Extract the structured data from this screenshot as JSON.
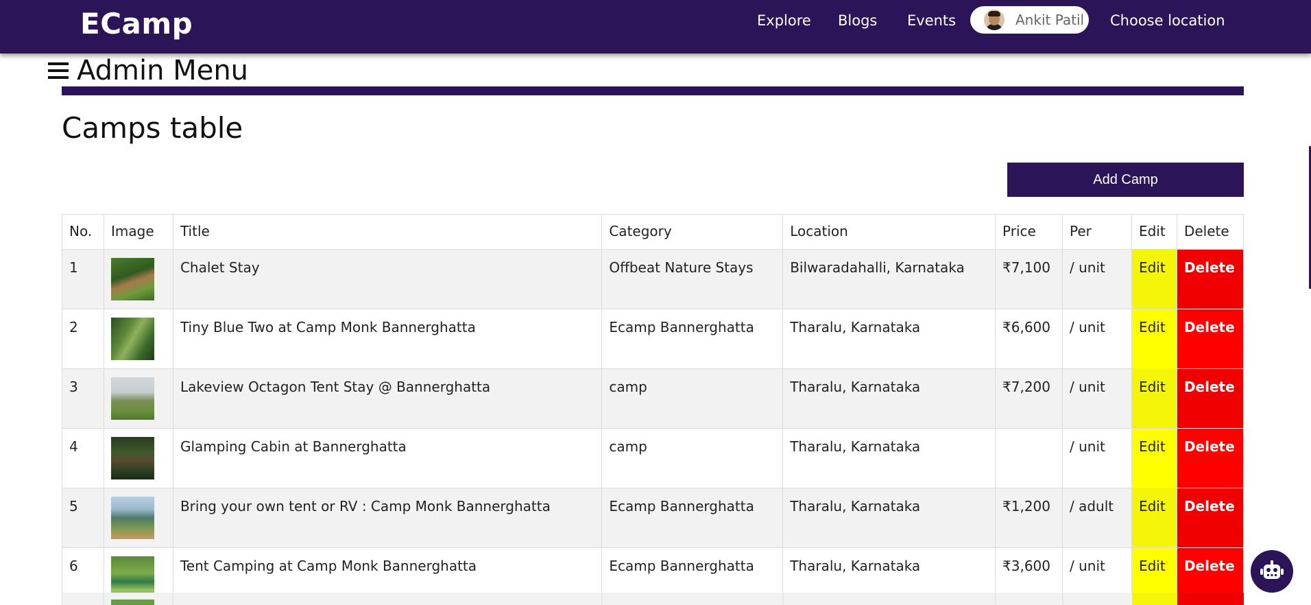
{
  "navbar": {
    "brand": "ECamp",
    "links": {
      "explore": "Explore",
      "blogs": "Blogs",
      "events": "Events",
      "location": "Choose location"
    },
    "user": {
      "name": "Ankit Patil"
    }
  },
  "admin_menu": {
    "label": "Admin Menu"
  },
  "page": {
    "title": "Camps table",
    "add_button": "Add Camp"
  },
  "table": {
    "headers": [
      "No.",
      "Image",
      "Title",
      "Category",
      "Location",
      "Price",
      "Per",
      "Edit",
      "Delete"
    ],
    "rows": [
      {
        "no": "1",
        "title": "Chalet Stay",
        "category": "Offbeat Nature Stays",
        "location": "Bilwaradahalli, Karnataka",
        "price": "₹7,100",
        "per": "/ unit",
        "edit": "Edit",
        "delete": "Delete"
      },
      {
        "no": "2",
        "title": "Tiny Blue Two at Camp Monk Bannerghatta",
        "category": "Ecamp Bannerghatta",
        "location": "Tharalu, Karnataka",
        "price": "₹6,600",
        "per": "/ unit",
        "edit": "Edit",
        "delete": "Delete"
      },
      {
        "no": "3",
        "title": "Lakeview Octagon Tent Stay @ Bannerghatta",
        "category": "camp",
        "location": "Tharalu, Karnataka",
        "price": "₹7,200",
        "per": "/ unit",
        "edit": "Edit",
        "delete": "Delete"
      },
      {
        "no": "4",
        "title": "Glamping Cabin at Bannerghatta",
        "category": "camp",
        "location": "Tharalu, Karnataka",
        "price": "",
        "per": "/ unit",
        "edit": "Edit",
        "delete": "Delete"
      },
      {
        "no": "5",
        "title": "Bring your own tent or RV : Camp Monk Bannerghatta",
        "category": "Ecamp Bannerghatta",
        "location": "Tharalu, Karnataka",
        "price": "₹1,200",
        "per": "/ adult",
        "edit": "Edit",
        "delete": "Delete"
      },
      {
        "no": "6",
        "title": "Tent Camping at Camp Monk Bannerghatta",
        "category": "Ecamp Bannerghatta",
        "location": "Tharalu, Karnataka",
        "price": "₹3,600",
        "per": "/ unit",
        "edit": "Edit",
        "delete": "Delete"
      }
    ]
  },
  "colors": {
    "primary": "#2b1558",
    "edit": "#ffff00",
    "delete": "#ff0000"
  },
  "icons": {
    "menu": "hamburger-icon",
    "chatbot": "robot-icon"
  }
}
